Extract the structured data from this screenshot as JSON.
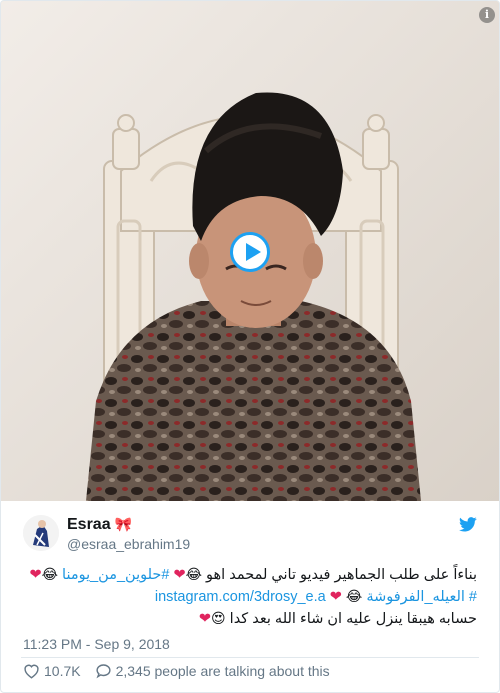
{
  "media": {
    "info_icon": "i"
  },
  "tweet": {
    "author_name": "Esraa",
    "author_emoji": "🎀",
    "handle": "@esraa_ebrahim19",
    "text_lines": {
      "line1_plain": "بناءاً على طلب الجماهير فيديو تاني لمحمد اهو",
      "line1_emoji1": "😂",
      "line1_heart1": "❤",
      "line1_hashtag": "#حلوين_من_يومنا",
      "line1_emoji2": "😂",
      "line1_heart2": "❤",
      "line2_hashtag": "# العيله_الفرفوشة",
      "line2_emoji": "😂",
      "line2_heart": "❤",
      "line2_link": "instagram.com/3drosy_e.a",
      "line3_plain": "حسابه هيبقا ينزل عليه ان شاء الله بعد كدا",
      "line3_emoji": "😍",
      "line3_heart": "❤"
    },
    "timestamp": "11:23 PM - Sep 9, 2018",
    "like_count": "10.7K",
    "talking": "2,345 people are talking about this"
  },
  "colors": {
    "link": "#1b95e0",
    "heart": "#e0245e",
    "muted": "#657786"
  }
}
